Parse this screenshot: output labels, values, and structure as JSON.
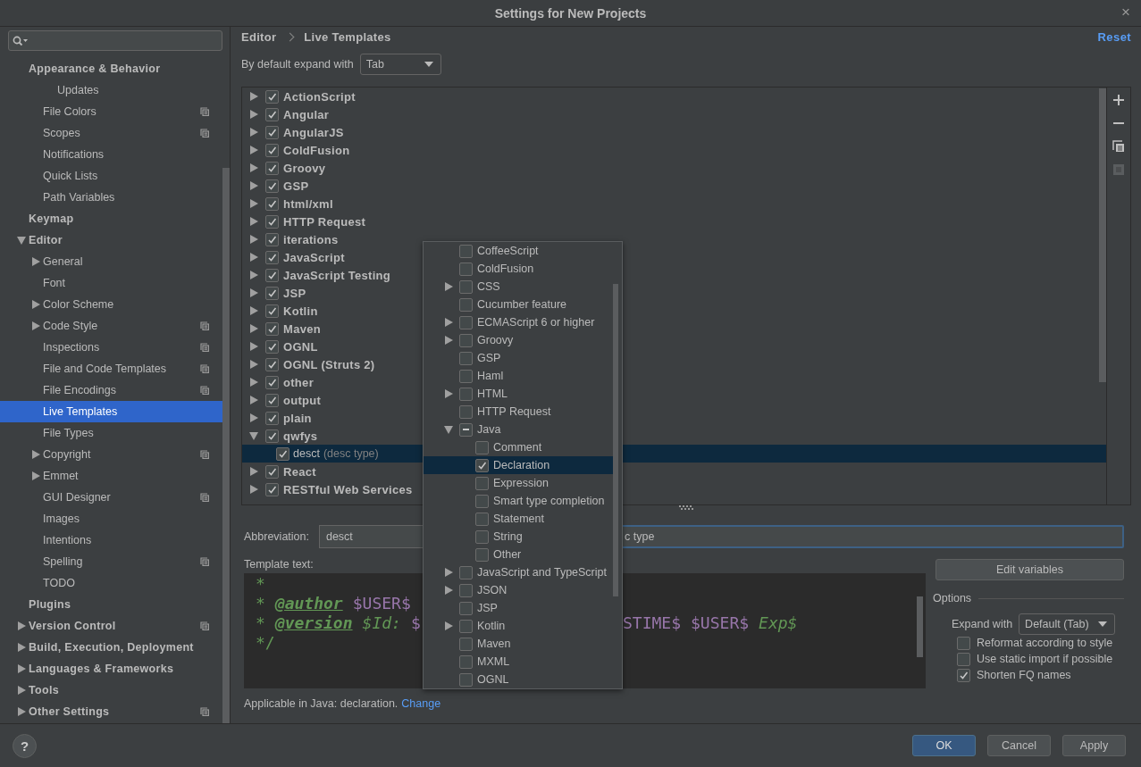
{
  "window": {
    "title": "Settings for New Projects",
    "close": "×"
  },
  "sidebar": {
    "items": [
      {
        "label": "Appearance & Behavior",
        "selected": false,
        "project_icon": false,
        "children": [
          {
            "children": [
              {
                "label": "Updates",
                "selected": false,
                "project_icon": false
              }
            ]
          },
          {
            "label": "File Colors",
            "selected": false,
            "project_icon": true
          },
          {
            "label": "Scopes",
            "selected": false,
            "project_icon": true
          },
          {
            "label": "Notifications",
            "selected": false,
            "project_icon": false
          },
          {
            "label": "Quick Lists",
            "selected": false,
            "project_icon": false
          },
          {
            "label": "Path Variables",
            "selected": false,
            "project_icon": false
          }
        ]
      },
      {
        "label": "Keymap",
        "selected": false,
        "project_icon": false
      },
      {
        "label": "Editor",
        "expanded": true,
        "selected": false,
        "project_icon": false,
        "children": [
          {
            "label": "General",
            "expanded": false,
            "selected": false,
            "project_icon": false
          },
          {
            "label": "Font",
            "selected": false,
            "project_icon": false
          },
          {
            "label": "Color Scheme",
            "expanded": false,
            "selected": false,
            "project_icon": false
          },
          {
            "label": "Code Style",
            "expanded": false,
            "selected": false,
            "project_icon": true
          },
          {
            "label": "Inspections",
            "selected": false,
            "project_icon": true
          },
          {
            "label": "File and Code Templates",
            "selected": false,
            "project_icon": true
          },
          {
            "label": "File Encodings",
            "selected": false,
            "project_icon": true
          },
          {
            "label": "Live Templates",
            "selected": true,
            "project_icon": false
          },
          {
            "label": "File Types",
            "selected": false,
            "project_icon": false
          },
          {
            "label": "Copyright",
            "expanded": false,
            "selected": false,
            "project_icon": true
          },
          {
            "label": "Emmet",
            "expanded": false,
            "selected": false,
            "project_icon": false
          },
          {
            "label": "GUI Designer",
            "selected": false,
            "project_icon": true
          },
          {
            "label": "Images",
            "selected": false,
            "project_icon": false
          },
          {
            "label": "Intentions",
            "selected": false,
            "project_icon": false
          },
          {
            "label": "Spelling",
            "selected": false,
            "project_icon": true
          },
          {
            "label": "TODO",
            "selected": false,
            "project_icon": false
          }
        ]
      },
      {
        "label": "Plugins",
        "selected": false,
        "project_icon": false
      },
      {
        "label": "Version Control",
        "expanded": false,
        "selected": false,
        "project_icon": true
      },
      {
        "label": "Build, Execution, Deployment",
        "expanded": false,
        "selected": false,
        "project_icon": false
      },
      {
        "label": "Languages & Frameworks",
        "expanded": false,
        "selected": false,
        "project_icon": false
      },
      {
        "label": "Tools",
        "expanded": false,
        "selected": false,
        "project_icon": false
      },
      {
        "label": "Other Settings",
        "expanded": false,
        "selected": false,
        "project_icon": true
      }
    ]
  },
  "breadcrumb": [
    "Editor",
    "Live Templates"
  ],
  "reset": "Reset",
  "expand_default": {
    "label": "By default expand with",
    "value": "Tab"
  },
  "templates": {
    "groups": [
      {
        "name": "ActionScript",
        "checked": true,
        "expanded": false,
        "selected": false
      },
      {
        "name": "Angular",
        "checked": true,
        "expanded": false,
        "selected": false
      },
      {
        "name": "AngularJS",
        "checked": true,
        "expanded": false,
        "selected": false
      },
      {
        "name": "ColdFusion",
        "checked": true,
        "expanded": false,
        "selected": false
      },
      {
        "name": "Groovy",
        "checked": true,
        "expanded": false,
        "selected": false
      },
      {
        "name": "GSP",
        "checked": true,
        "expanded": false,
        "selected": false
      },
      {
        "name": "html/xml",
        "checked": true,
        "expanded": false,
        "selected": false
      },
      {
        "name": "HTTP Request",
        "checked": true,
        "expanded": false,
        "selected": false
      },
      {
        "name": "iterations",
        "checked": true,
        "expanded": false,
        "selected": false
      },
      {
        "name": "JavaScript",
        "checked": true,
        "expanded": false,
        "selected": false
      },
      {
        "name": "JavaScript Testing",
        "checked": true,
        "expanded": false,
        "selected": false
      },
      {
        "name": "JSP",
        "checked": true,
        "expanded": false,
        "selected": false
      },
      {
        "name": "Kotlin",
        "checked": true,
        "expanded": false,
        "selected": false
      },
      {
        "name": "Maven",
        "checked": true,
        "expanded": false,
        "selected": false
      },
      {
        "name": "OGNL",
        "checked": true,
        "expanded": false,
        "selected": false
      },
      {
        "name": "OGNL (Struts 2)",
        "checked": true,
        "expanded": false,
        "selected": false
      },
      {
        "name": "other",
        "checked": true,
        "expanded": false,
        "selected": false
      },
      {
        "name": "output",
        "checked": true,
        "expanded": false,
        "selected": false
      },
      {
        "name": "plain",
        "checked": true,
        "expanded": false,
        "selected": false
      },
      {
        "name": "qwfys",
        "checked": true,
        "expanded": true,
        "selected": false,
        "children": [
          {
            "abbreviation": "desct",
            "description": "(desc type)",
            "checked": true,
            "selected": true
          }
        ]
      },
      {
        "name": "React",
        "checked": true,
        "expanded": false,
        "selected": false
      },
      {
        "name": "RESTful Web Services",
        "checked": true,
        "expanded": false,
        "selected": false
      }
    ]
  },
  "toolbar": [
    {
      "kind": "add",
      "disabled": false
    },
    {
      "kind": "remove",
      "disabled": false
    },
    {
      "kind": "copy",
      "disabled": false
    },
    {
      "kind": "list",
      "disabled": true
    }
  ],
  "abbreviation": {
    "label": "Abbreviation:",
    "value": "desct"
  },
  "description": {
    "value": "c type",
    "focused": true
  },
  "template_text": {
    "label": "Template text:",
    "lines": [
      {
        "tokens": [
          {
            "kind": "comment",
            "text": "*"
          }
        ]
      },
      {
        "tokens": [
          {
            "kind": "comment",
            "text": "*"
          },
          {
            "kind": "tag",
            "text": "@author"
          },
          {
            "kind": "var",
            "text": "$USER$"
          }
        ]
      },
      {
        "tokens": [
          {
            "kind": "comment",
            "text": "*"
          },
          {
            "kind": "tag",
            "text": "@version"
          },
          {
            "kind": "italic",
            "text": "$Id:"
          },
          {
            "kind": "var",
            "text": "$"
          }
        ],
        "tail": [
          {
            "kind": "var",
            "text": "STIME$"
          },
          {
            "kind": "var",
            "text": "$USER$"
          },
          {
            "kind": "italic",
            "text": "Exp$"
          }
        ]
      },
      {
        "tokens": [
          {
            "kind": "comment",
            "text": "*/"
          }
        ]
      }
    ]
  },
  "edit_variables": "Edit variables",
  "options": {
    "title": "Options",
    "expand_label": "Expand with",
    "expand_value": "Default (Tab)",
    "checks": [
      {
        "label": "Reformat according to style",
        "checked": false
      },
      {
        "label": "Use static import if possible",
        "checked": false
      },
      {
        "label": "Shorten FQ names",
        "checked": true
      }
    ]
  },
  "applicable": {
    "text": "Applicable in Java: declaration.",
    "link": "Change"
  },
  "popup": {
    "items": [
      {
        "label": "CoffeeScript",
        "checked": false,
        "selected": false
      },
      {
        "label": "ColdFusion",
        "checked": false,
        "selected": false
      },
      {
        "label": "CSS",
        "expanded": false,
        "checked": false,
        "selected": false
      },
      {
        "label": "Cucumber feature",
        "checked": false,
        "selected": false
      },
      {
        "label": "ECMAScript 6 or higher",
        "expanded": false,
        "checked": false,
        "selected": false
      },
      {
        "label": "Groovy",
        "expanded": false,
        "checked": false,
        "selected": false
      },
      {
        "label": "GSP",
        "checked": false,
        "selected": false
      },
      {
        "label": "Haml",
        "checked": false,
        "selected": false
      },
      {
        "label": "HTML",
        "expanded": false,
        "checked": false,
        "selected": false
      },
      {
        "label": "HTTP Request",
        "checked": false,
        "selected": false
      },
      {
        "label": "Java",
        "expanded": true,
        "partial": true,
        "selected": false,
        "children": [
          {
            "label": "Comment",
            "checked": false,
            "selected": false
          },
          {
            "label": "Declaration",
            "checked": true,
            "selected": true
          },
          {
            "label": "Expression",
            "checked": false,
            "selected": false
          },
          {
            "label": "Smart type completion",
            "checked": false,
            "selected": false
          },
          {
            "label": "Statement",
            "checked": false,
            "selected": false
          },
          {
            "label": "String",
            "checked": false,
            "selected": false
          },
          {
            "label": "Other",
            "checked": false,
            "selected": false
          }
        ]
      },
      {
        "label": "JavaScript and TypeScript",
        "expanded": false,
        "checked": false,
        "selected": false
      },
      {
        "label": "JSON",
        "expanded": false,
        "checked": false,
        "selected": false
      },
      {
        "label": "JSP",
        "checked": false,
        "selected": false
      },
      {
        "label": "Kotlin",
        "expanded": false,
        "checked": false,
        "selected": false
      },
      {
        "label": "Maven",
        "checked": false,
        "selected": false
      },
      {
        "label": "MXML",
        "checked": false,
        "selected": false
      },
      {
        "label": "OGNL",
        "checked": false,
        "selected": false
      }
    ]
  },
  "help": "?",
  "buttons": [
    {
      "label": "OK",
      "default": true
    },
    {
      "label": "Cancel",
      "default": false
    },
    {
      "label": "Apply",
      "default": false
    }
  ]
}
